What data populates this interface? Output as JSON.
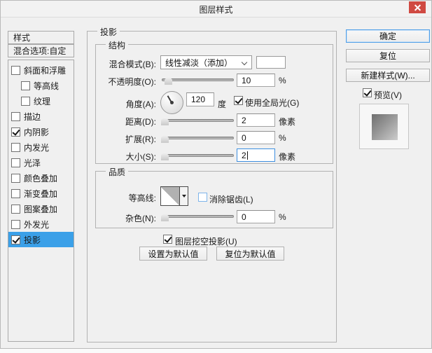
{
  "window": {
    "title": "图层样式"
  },
  "sidebar": {
    "header": "样式",
    "blending_options": "混合选项:自定",
    "items": [
      {
        "label": "斜面和浮雕",
        "checked": false,
        "indent": false,
        "selected": false
      },
      {
        "label": "等高线",
        "checked": false,
        "indent": true,
        "selected": false
      },
      {
        "label": "纹理",
        "checked": false,
        "indent": true,
        "selected": false
      },
      {
        "label": "描边",
        "checked": false,
        "indent": false,
        "selected": false
      },
      {
        "label": "内阴影",
        "checked": true,
        "indent": false,
        "selected": false
      },
      {
        "label": "内发光",
        "checked": false,
        "indent": false,
        "selected": false
      },
      {
        "label": "光泽",
        "checked": false,
        "indent": false,
        "selected": false
      },
      {
        "label": "颜色叠加",
        "checked": false,
        "indent": false,
        "selected": false
      },
      {
        "label": "渐变叠加",
        "checked": false,
        "indent": false,
        "selected": false
      },
      {
        "label": "图案叠加",
        "checked": false,
        "indent": false,
        "selected": false
      },
      {
        "label": "外发光",
        "checked": false,
        "indent": false,
        "selected": false
      },
      {
        "label": "投影",
        "checked": true,
        "indent": false,
        "selected": true
      }
    ]
  },
  "main": {
    "panel_title": "投影",
    "structure": {
      "title": "结构",
      "blend_mode_label": "混合模式(B):",
      "blend_mode_value": "线性减淡（添加）",
      "opacity_label": "不透明度(O):",
      "opacity_value": "10",
      "opacity_unit": "%",
      "angle_label": "角度(A):",
      "angle_value": "120",
      "angle_unit": "度",
      "global_light_label": "使用全局光(G)",
      "distance_label": "距离(D):",
      "distance_value": "2",
      "distance_unit": "像素",
      "spread_label": "扩展(R):",
      "spread_value": "0",
      "spread_unit": "%",
      "size_label": "大小(S):",
      "size_value": "2",
      "size_unit": "像素"
    },
    "quality": {
      "title": "品质",
      "contour_label": "等高线:",
      "anti_alias_label": "消除锯齿(L)",
      "noise_label": "杂色(N):",
      "noise_value": "0",
      "noise_unit": "%"
    },
    "knockout_label": "图层挖空投影(U)",
    "set_default_label": "设置为默认值",
    "reset_default_label": "复位为默认值"
  },
  "actions": {
    "ok": "确定",
    "reset": "复位",
    "new_style": "新建样式(W)...",
    "preview_label": "预览(V)"
  },
  "colors": {
    "selection_blue": "#3ba0e8",
    "close_red": "#d04a42",
    "focus_blue": "#4f9ee8",
    "dialog_bg": "#f0f0f0",
    "swatch_color": "#ffffff"
  }
}
